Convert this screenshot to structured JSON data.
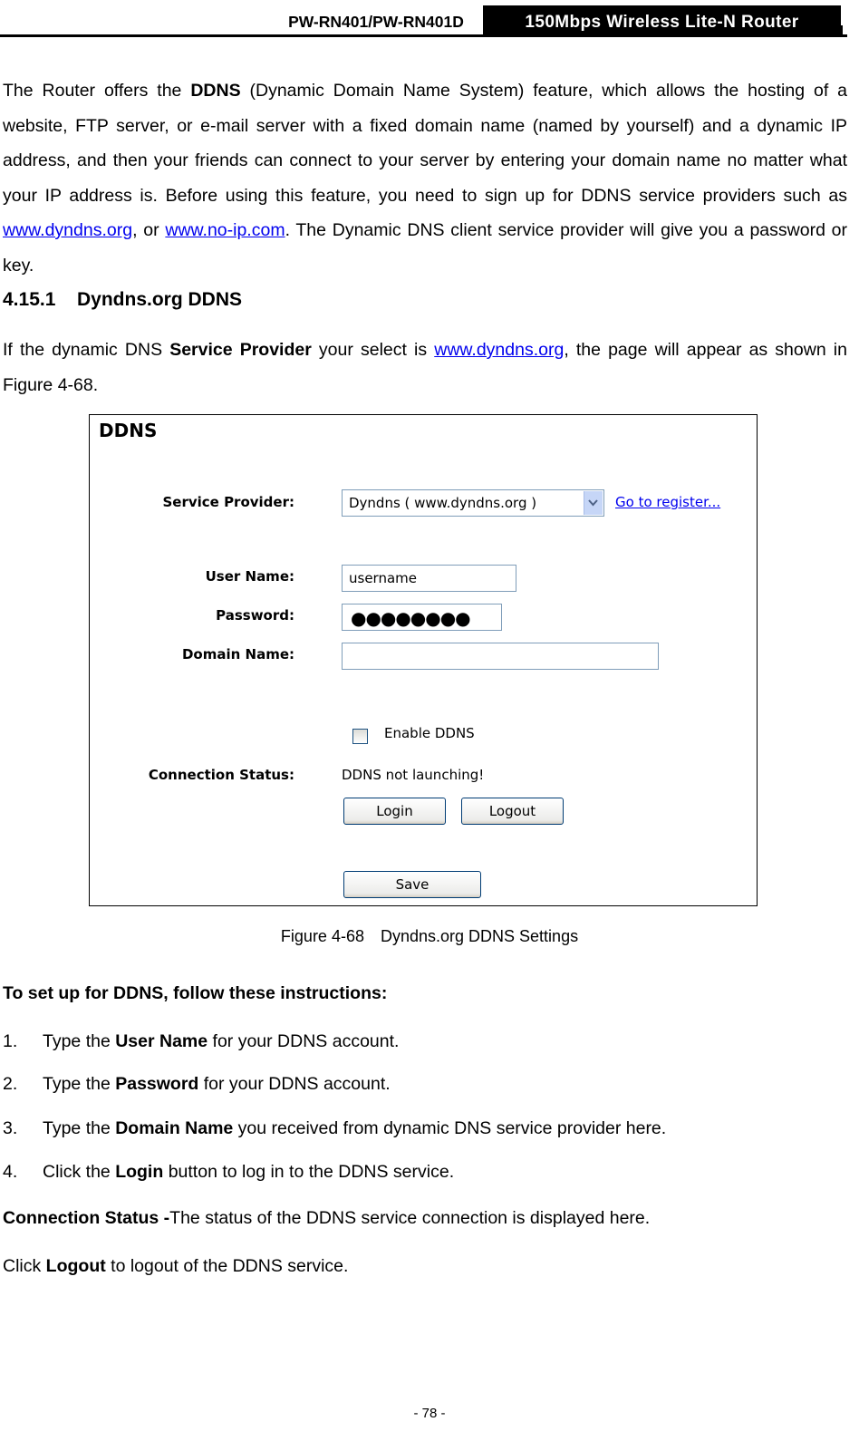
{
  "header": {
    "model": "PW-RN401/PW-RN401D",
    "product": "150Mbps  Wireless  Lite-N  Router"
  },
  "intro": {
    "p1": "The Router offers the ",
    "ddns_bold": "DDNS",
    "p2": " (Dynamic Domain Name System) feature, which allows the hosting of a website, FTP server, or e-mail server with a fixed domain name (named by yourself) and a dynamic IP address, and then your friends can connect to your server by entering your domain name no matter what your IP address is. Before using this feature, you need to sign up for DDNS service providers such as ",
    "link1": "www.dyndns.org",
    "p3": ", or ",
    "link2": "www.no-ip.com",
    "p4": ". The Dynamic DNS client service provider will give you a password or key."
  },
  "section": {
    "number": "4.15.1",
    "title": "Dyndns.org DDNS",
    "p1": "If the dynamic DNS ",
    "bold": "Service Provider",
    "p2": " your select is ",
    "link": "www.dyndns.org",
    "p3": ", the page will appear as shown in Figure 4-68."
  },
  "figure": {
    "title": "DDNS",
    "service_provider_label": "Service Provider:",
    "service_provider_value": "Dyndns ( www.dyndns.org )",
    "register_link": "Go to register...",
    "username_label": "User Name:",
    "username_value": "username",
    "password_label": "Password:",
    "password_value": "●●●●●●●●",
    "domain_label": "Domain Name:",
    "domain_value": "",
    "enable_label": "Enable DDNS",
    "enable_checked": false,
    "status_label": "Connection Status:",
    "status_value": "DDNS not launching!",
    "login_button": "Login",
    "logout_button": "Logout",
    "save_button": "Save"
  },
  "caption": {
    "number": "Figure 4-68",
    "text": "Dyndns.org DDNS Settings"
  },
  "instructions": {
    "heading": "To set up for DDNS, follow these instructions:",
    "steps": [
      {
        "n": "1.",
        "pre": "Type the ",
        "bold": "User Name",
        "post": " for your DDNS account."
      },
      {
        "n": "2.",
        "pre": "Type the ",
        "bold": "Password",
        "post": " for your DDNS account."
      },
      {
        "n": "3.",
        "pre": "Type the ",
        "bold": "Domain Name",
        "post": " you received from dynamic DNS service provider here."
      },
      {
        "n": "4.",
        "pre": "Click the ",
        "bold": "Login",
        "post": " button to log in to the DDNS service."
      }
    ],
    "status_bold": "Connection Status -",
    "status_text": "The status of the DDNS service connection is displayed here.",
    "logout_pre": "Click ",
    "logout_bold": "Logout",
    "logout_post": " to logout of the DDNS service."
  },
  "footer": {
    "page": "- 78 -"
  }
}
